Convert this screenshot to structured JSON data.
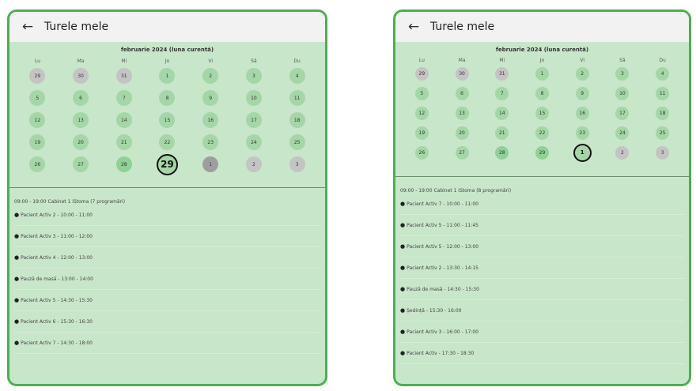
{
  "left": {
    "title": "Turele mele",
    "back_icon": "arrow-left-icon",
    "month_label": "februarie 2024  (luna curentă)",
    "weekdays": [
      "Lu",
      "Ma",
      "Mi",
      "Jo",
      "Vi",
      "Sâ",
      "Du"
    ],
    "days": [
      {
        "n": "29",
        "s": "other"
      },
      {
        "n": "30",
        "s": "other"
      },
      {
        "n": "31",
        "s": "other"
      },
      {
        "n": "1",
        "s": "cur"
      },
      {
        "n": "2",
        "s": "cur"
      },
      {
        "n": "3",
        "s": "cur"
      },
      {
        "n": "4",
        "s": "cur"
      },
      {
        "n": "5",
        "s": "cur"
      },
      {
        "n": "6",
        "s": "cur"
      },
      {
        "n": "7",
        "s": "cur"
      },
      {
        "n": "8",
        "s": "cur"
      },
      {
        "n": "9",
        "s": "cur"
      },
      {
        "n": "10",
        "s": "cur"
      },
      {
        "n": "11",
        "s": "cur"
      },
      {
        "n": "12",
        "s": "cur"
      },
      {
        "n": "13",
        "s": "cur"
      },
      {
        "n": "14",
        "s": "cur"
      },
      {
        "n": "15",
        "s": "cur"
      },
      {
        "n": "16",
        "s": "cur"
      },
      {
        "n": "17",
        "s": "cur"
      },
      {
        "n": "18",
        "s": "cur"
      },
      {
        "n": "19",
        "s": "cur"
      },
      {
        "n": "20",
        "s": "cur"
      },
      {
        "n": "21",
        "s": "cur"
      },
      {
        "n": "22",
        "s": "cur"
      },
      {
        "n": "23",
        "s": "cur"
      },
      {
        "n": "24",
        "s": "cur"
      },
      {
        "n": "25",
        "s": "cur"
      },
      {
        "n": "26",
        "s": "cur"
      },
      {
        "n": "27",
        "s": "cur"
      },
      {
        "n": "28",
        "s": "past"
      },
      {
        "n": "29",
        "s": "selected"
      },
      {
        "n": "1",
        "s": "future dark"
      },
      {
        "n": "2",
        "s": "future"
      },
      {
        "n": "3",
        "s": "future"
      }
    ],
    "schedule_header": "09:00 - 19:00 Cabinet 1 iStoma (7 programări)",
    "appointments": [
      {
        "text": "Pacient Activ 2 - 10:00 - 11:00",
        "gap": 0
      },
      {
        "text": "Pacient Activ 3 - 11:00 - 12:00",
        "gap": 0
      },
      {
        "text": "Pacient Activ 4 - 12:00 - 13:00",
        "gap": 0
      },
      {
        "text": "Pauză de masă - 13:00 - 14:00",
        "gap": 0
      },
      {
        "text": "Pacient Activ 5 - 14:30 - 15:30",
        "gap": 0
      },
      {
        "text": "Pacient Activ 6 - 15:30 - 16:30",
        "gap": 0
      },
      {
        "text": "Pacient Activ 7 - 14:30 - 18:00",
        "gap": 0
      }
    ]
  },
  "right": {
    "title": "Turele mele",
    "back_icon": "arrow-left-icon",
    "month_label": "februarie 2024  (luna curentă)",
    "weekdays": [
      "Lu",
      "Ma",
      "Mi",
      "Jo",
      "Vi",
      "Sâ",
      "Du"
    ],
    "days": [
      {
        "n": "29",
        "s": "other"
      },
      {
        "n": "30",
        "s": "other"
      },
      {
        "n": "31",
        "s": "other"
      },
      {
        "n": "1",
        "s": "cur"
      },
      {
        "n": "2",
        "s": "cur"
      },
      {
        "n": "3",
        "s": "cur"
      },
      {
        "n": "4",
        "s": "cur"
      },
      {
        "n": "5",
        "s": "cur"
      },
      {
        "n": "6",
        "s": "cur"
      },
      {
        "n": "7",
        "s": "cur"
      },
      {
        "n": "8",
        "s": "cur"
      },
      {
        "n": "9",
        "s": "cur"
      },
      {
        "n": "10",
        "s": "cur"
      },
      {
        "n": "11",
        "s": "cur"
      },
      {
        "n": "12",
        "s": "cur"
      },
      {
        "n": "13",
        "s": "cur"
      },
      {
        "n": "14",
        "s": "cur"
      },
      {
        "n": "15",
        "s": "cur"
      },
      {
        "n": "16",
        "s": "cur"
      },
      {
        "n": "17",
        "s": "cur"
      },
      {
        "n": "18",
        "s": "cur"
      },
      {
        "n": "19",
        "s": "cur"
      },
      {
        "n": "20",
        "s": "cur"
      },
      {
        "n": "21",
        "s": "cur"
      },
      {
        "n": "22",
        "s": "cur"
      },
      {
        "n": "23",
        "s": "cur"
      },
      {
        "n": "24",
        "s": "cur"
      },
      {
        "n": "25",
        "s": "cur"
      },
      {
        "n": "26",
        "s": "cur"
      },
      {
        "n": "27",
        "s": "cur"
      },
      {
        "n": "28",
        "s": "past"
      },
      {
        "n": "29",
        "s": "past bold"
      },
      {
        "n": "1",
        "s": "selected"
      },
      {
        "n": "2",
        "s": "future"
      },
      {
        "n": "3",
        "s": "future"
      }
    ],
    "schedule_header": "09:00 - 19:00 Cabinet 1 iStoma (8 programări)",
    "appointments": [
      {
        "text": "Pacient Activ 7 - 10:00 - 11:00",
        "gap": 0
      },
      {
        "text": "Pacient Activ 5 - 11:00 - 11:45",
        "gap": 0
      },
      {
        "text": "Pacient Activ 5 - 12:00 - 13:00",
        "gap": 0
      },
      {
        "text": "Pacient Activ 2 - 13:30 - 14:15",
        "gap": 0
      },
      {
        "text": "Pauză de masă - 14:30 - 15:30",
        "gap": 0
      },
      {
        "text": "Ședință - 15:30 - 16:00",
        "gap": 0
      },
      {
        "text": "Pacient Activ 3 - 16:00 - 17:00",
        "gap": 0
      },
      {
        "text": "Pacient Activ - 17:30 - 18:30",
        "gap": 0
      }
    ]
  }
}
